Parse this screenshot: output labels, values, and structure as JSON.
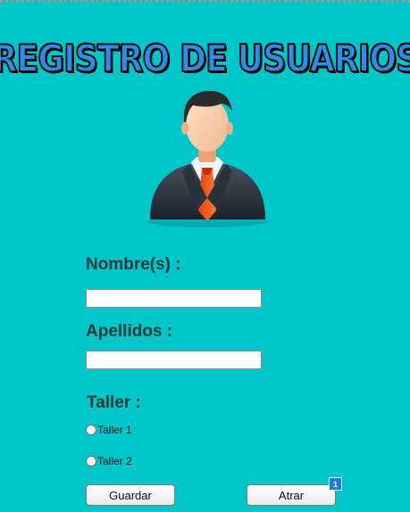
{
  "banner": {
    "title": "REGISTRO DE USUARIOS"
  },
  "form": {
    "nombre_label": "Nombre(s) :",
    "nombre_value": "",
    "apellidos_label": "Apellidos :",
    "apellidos_value": "",
    "taller_label": "Taller :",
    "taller_options": [
      {
        "label": "Taller 1",
        "selected": false
      },
      {
        "label": "Taller 2",
        "selected": false
      }
    ]
  },
  "buttons": {
    "guardar": "Guardar",
    "atras": "Atrar"
  },
  "badge": {
    "count": "1"
  },
  "colors": {
    "background": "#00c6c9",
    "title_fill": "#2a8fe8",
    "label_text": "#1f3a3a"
  },
  "icons": {
    "avatar": "businessman-avatar-icon",
    "radio": "radio-icon"
  }
}
